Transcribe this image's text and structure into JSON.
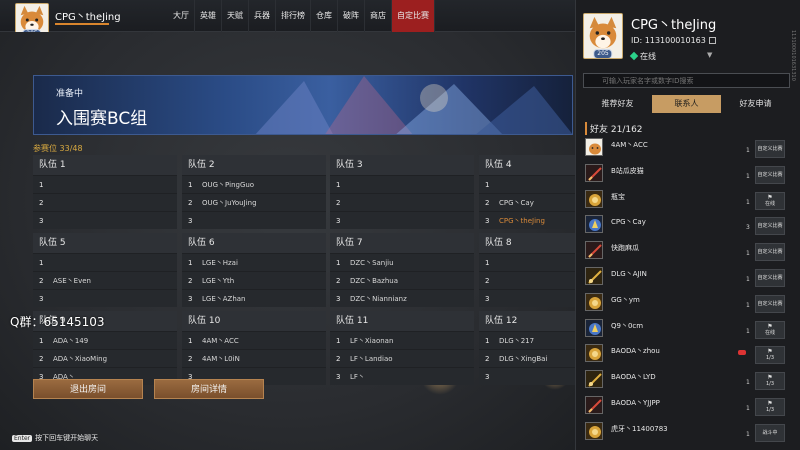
{
  "header": {
    "username": "CPG丶theJing",
    "level": "205",
    "xp_progress": 1.0,
    "nav": [
      "大厅",
      "英雄",
      "天赋",
      "兵器",
      "排行榜",
      "仓库",
      "破阵",
      "商店",
      "自定比赛"
    ],
    "active_nav": "自定比赛"
  },
  "room": {
    "status": "准备中",
    "title": "入围赛BC组",
    "seats_label": "参赛位 33/48",
    "teams": [
      {
        "name": "队伍 1",
        "slots": [
          {
            "num": "1",
            "name": ""
          },
          {
            "num": "2",
            "name": ""
          },
          {
            "num": "3",
            "name": ""
          }
        ]
      },
      {
        "name": "队伍 2",
        "slots": [
          {
            "num": "1",
            "name": "OUG丶PingGuo"
          },
          {
            "num": "2",
            "name": "OUG丶JuYouJing"
          },
          {
            "num": "3",
            "name": ""
          }
        ]
      },
      {
        "name": "队伍 3",
        "slots": [
          {
            "num": "1",
            "name": ""
          },
          {
            "num": "2",
            "name": ""
          },
          {
            "num": "3",
            "name": ""
          }
        ]
      },
      {
        "name": "队伍 4",
        "slots": [
          {
            "num": "1",
            "name": ""
          },
          {
            "num": "2",
            "name": "CPG丶Cay"
          },
          {
            "num": "3",
            "name": "CPG丶theJing",
            "me": true
          }
        ]
      },
      {
        "name": "队伍 5",
        "slots": [
          {
            "num": "1",
            "name": ""
          },
          {
            "num": "2",
            "name": "ASE丶Even"
          },
          {
            "num": "3",
            "name": ""
          }
        ]
      },
      {
        "name": "队伍 6",
        "slots": [
          {
            "num": "1",
            "name": "LGE丶Hzai"
          },
          {
            "num": "2",
            "name": "LGE丶Yth"
          },
          {
            "num": "3",
            "name": "LGE丶AZhan"
          }
        ]
      },
      {
        "name": "队伍 7",
        "slots": [
          {
            "num": "1",
            "name": "DZC丶Sanjiu"
          },
          {
            "num": "2",
            "name": "DZC丶Bazhua"
          },
          {
            "num": "3",
            "name": "DZC丶Niannianz"
          }
        ]
      },
      {
        "name": "队伍 8",
        "slots": [
          {
            "num": "1",
            "name": ""
          },
          {
            "num": "2",
            "name": ""
          },
          {
            "num": "3",
            "name": ""
          }
        ]
      },
      {
        "name": "队伍 9",
        "slots": [
          {
            "num": "1",
            "name": "ADA丶149"
          },
          {
            "num": "2",
            "name": "ADA丶XiaoMing"
          },
          {
            "num": "3",
            "name": "ADA丶"
          }
        ]
      },
      {
        "name": "队伍 10",
        "slots": [
          {
            "num": "1",
            "name": "4AM丶ACC"
          },
          {
            "num": "2",
            "name": "4AM丶L0iN"
          },
          {
            "num": "3",
            "name": ""
          }
        ]
      },
      {
        "name": "队伍 11",
        "slots": [
          {
            "num": "1",
            "name": "LF丶Xiaonan"
          },
          {
            "num": "2",
            "name": "LF丶Landiao"
          },
          {
            "num": "3",
            "name": "LF丶"
          }
        ]
      },
      {
        "name": "队伍 12",
        "slots": [
          {
            "num": "1",
            "name": "DLG丶217"
          },
          {
            "num": "2",
            "name": "DLG丶XingBai"
          },
          {
            "num": "3",
            "name": ""
          }
        ]
      }
    ],
    "exit_button": "退出房间",
    "details_button": "房间详情"
  },
  "overlay": {
    "qq_group": "Q群：65145103",
    "enter_key": "Enter",
    "chat_hint": "按下回车键开始聊天"
  },
  "profile": {
    "name": "CPG丶theJing",
    "id_label": "ID: 113100010163",
    "status": "在线",
    "level": "205",
    "side_text": "1131000101631310"
  },
  "friends_panel": {
    "search_placeholder": "可输入玩家名字或数字ID搜索",
    "tabs": [
      "推荐好友",
      "联系人",
      "好友申请"
    ],
    "active_tab": "联系人",
    "header": "好友  21/162",
    "friends": [
      {
        "name": "4AM丶ACC",
        "count": "1",
        "action": "自定义比赛",
        "icon": "dog-avatar-icon"
      },
      {
        "name": "B站瓜皮猫",
        "count": "1",
        "action": "自定义比赛",
        "icon": "red-weapon-icon"
      },
      {
        "name": "瓶宝",
        "count": "1",
        "flag": "在线",
        "icon": "gold-emblem-icon"
      },
      {
        "name": "CPG丶Cay",
        "count": "3",
        "action": "自定义比赛",
        "icon": "blue-emblem-icon"
      },
      {
        "name": "快跑麻瓜",
        "count": "1",
        "action": "自定义比赛",
        "icon": "red-weapon-icon"
      },
      {
        "name": "DLG丶AJIN",
        "count": "1",
        "action": "自定义比赛",
        "icon": "gold-weapon-icon"
      },
      {
        "name": "GG丶ym",
        "count": "1",
        "action": "自定义比赛",
        "icon": "gold-emblem-icon"
      },
      {
        "name": "Q9丶0cm",
        "count": "1",
        "flag": "在线",
        "icon": "blue-emblem-icon"
      },
      {
        "name": "BAODA丶zhou",
        "count": "",
        "flag": "1/3",
        "icon": "gold-emblem-icon",
        "alert": true
      },
      {
        "name": "BAODA丶LYD",
        "count": "1",
        "flag": "1/3",
        "icon": "gold-weapon-icon"
      },
      {
        "name": "BAODA丶YJJPP",
        "count": "1",
        "flag": "1/3",
        "icon": "red-weapon-icon"
      },
      {
        "name": "虎牙丶11400783",
        "count": "1",
        "action": "战斗中",
        "icon": "gold-emblem-icon"
      }
    ]
  },
  "colors": {
    "accent": "#d98a3a",
    "active_nav": "#9c1f1f",
    "gold_text": "#d8a940",
    "button": "#8a5d35",
    "online": "#2bd18a"
  }
}
